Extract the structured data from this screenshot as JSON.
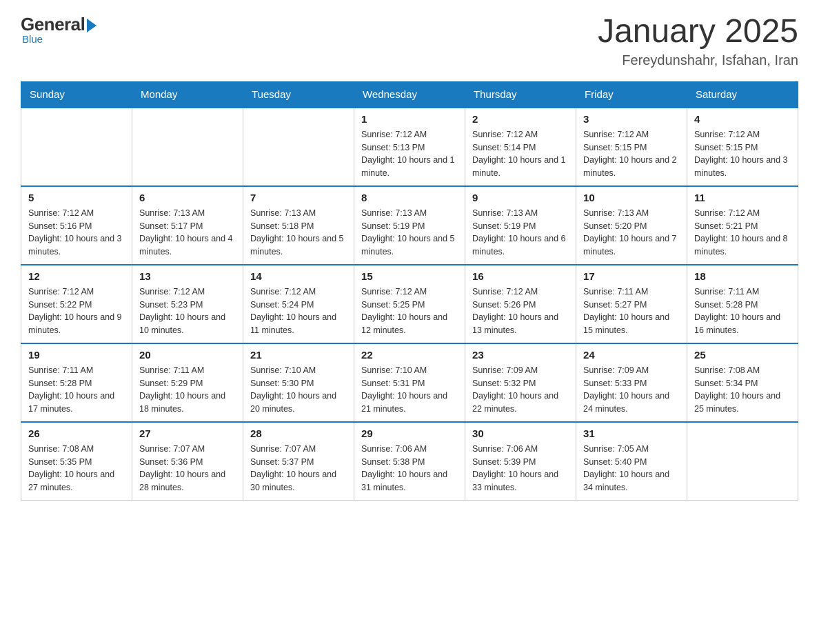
{
  "logo": {
    "general": "General",
    "blue": "Blue",
    "subtitle": "Blue"
  },
  "header": {
    "title": "January 2025",
    "location": "Fereydunshahr, Isfahan, Iran"
  },
  "days_of_week": [
    "Sunday",
    "Monday",
    "Tuesday",
    "Wednesday",
    "Thursday",
    "Friday",
    "Saturday"
  ],
  "weeks": [
    [
      {
        "day": "",
        "info": ""
      },
      {
        "day": "",
        "info": ""
      },
      {
        "day": "",
        "info": ""
      },
      {
        "day": "1",
        "info": "Sunrise: 7:12 AM\nSunset: 5:13 PM\nDaylight: 10 hours and 1 minute."
      },
      {
        "day": "2",
        "info": "Sunrise: 7:12 AM\nSunset: 5:14 PM\nDaylight: 10 hours and 1 minute."
      },
      {
        "day": "3",
        "info": "Sunrise: 7:12 AM\nSunset: 5:15 PM\nDaylight: 10 hours and 2 minutes."
      },
      {
        "day": "4",
        "info": "Sunrise: 7:12 AM\nSunset: 5:15 PM\nDaylight: 10 hours and 3 minutes."
      }
    ],
    [
      {
        "day": "5",
        "info": "Sunrise: 7:12 AM\nSunset: 5:16 PM\nDaylight: 10 hours and 3 minutes."
      },
      {
        "day": "6",
        "info": "Sunrise: 7:13 AM\nSunset: 5:17 PM\nDaylight: 10 hours and 4 minutes."
      },
      {
        "day": "7",
        "info": "Sunrise: 7:13 AM\nSunset: 5:18 PM\nDaylight: 10 hours and 5 minutes."
      },
      {
        "day": "8",
        "info": "Sunrise: 7:13 AM\nSunset: 5:19 PM\nDaylight: 10 hours and 5 minutes."
      },
      {
        "day": "9",
        "info": "Sunrise: 7:13 AM\nSunset: 5:19 PM\nDaylight: 10 hours and 6 minutes."
      },
      {
        "day": "10",
        "info": "Sunrise: 7:13 AM\nSunset: 5:20 PM\nDaylight: 10 hours and 7 minutes."
      },
      {
        "day": "11",
        "info": "Sunrise: 7:12 AM\nSunset: 5:21 PM\nDaylight: 10 hours and 8 minutes."
      }
    ],
    [
      {
        "day": "12",
        "info": "Sunrise: 7:12 AM\nSunset: 5:22 PM\nDaylight: 10 hours and 9 minutes."
      },
      {
        "day": "13",
        "info": "Sunrise: 7:12 AM\nSunset: 5:23 PM\nDaylight: 10 hours and 10 minutes."
      },
      {
        "day": "14",
        "info": "Sunrise: 7:12 AM\nSunset: 5:24 PM\nDaylight: 10 hours and 11 minutes."
      },
      {
        "day": "15",
        "info": "Sunrise: 7:12 AM\nSunset: 5:25 PM\nDaylight: 10 hours and 12 minutes."
      },
      {
        "day": "16",
        "info": "Sunrise: 7:12 AM\nSunset: 5:26 PM\nDaylight: 10 hours and 13 minutes."
      },
      {
        "day": "17",
        "info": "Sunrise: 7:11 AM\nSunset: 5:27 PM\nDaylight: 10 hours and 15 minutes."
      },
      {
        "day": "18",
        "info": "Sunrise: 7:11 AM\nSunset: 5:28 PM\nDaylight: 10 hours and 16 minutes."
      }
    ],
    [
      {
        "day": "19",
        "info": "Sunrise: 7:11 AM\nSunset: 5:28 PM\nDaylight: 10 hours and 17 minutes."
      },
      {
        "day": "20",
        "info": "Sunrise: 7:11 AM\nSunset: 5:29 PM\nDaylight: 10 hours and 18 minutes."
      },
      {
        "day": "21",
        "info": "Sunrise: 7:10 AM\nSunset: 5:30 PM\nDaylight: 10 hours and 20 minutes."
      },
      {
        "day": "22",
        "info": "Sunrise: 7:10 AM\nSunset: 5:31 PM\nDaylight: 10 hours and 21 minutes."
      },
      {
        "day": "23",
        "info": "Sunrise: 7:09 AM\nSunset: 5:32 PM\nDaylight: 10 hours and 22 minutes."
      },
      {
        "day": "24",
        "info": "Sunrise: 7:09 AM\nSunset: 5:33 PM\nDaylight: 10 hours and 24 minutes."
      },
      {
        "day": "25",
        "info": "Sunrise: 7:08 AM\nSunset: 5:34 PM\nDaylight: 10 hours and 25 minutes."
      }
    ],
    [
      {
        "day": "26",
        "info": "Sunrise: 7:08 AM\nSunset: 5:35 PM\nDaylight: 10 hours and 27 minutes."
      },
      {
        "day": "27",
        "info": "Sunrise: 7:07 AM\nSunset: 5:36 PM\nDaylight: 10 hours and 28 minutes."
      },
      {
        "day": "28",
        "info": "Sunrise: 7:07 AM\nSunset: 5:37 PM\nDaylight: 10 hours and 30 minutes."
      },
      {
        "day": "29",
        "info": "Sunrise: 7:06 AM\nSunset: 5:38 PM\nDaylight: 10 hours and 31 minutes."
      },
      {
        "day": "30",
        "info": "Sunrise: 7:06 AM\nSunset: 5:39 PM\nDaylight: 10 hours and 33 minutes."
      },
      {
        "day": "31",
        "info": "Sunrise: 7:05 AM\nSunset: 5:40 PM\nDaylight: 10 hours and 34 minutes."
      },
      {
        "day": "",
        "info": ""
      }
    ]
  ]
}
